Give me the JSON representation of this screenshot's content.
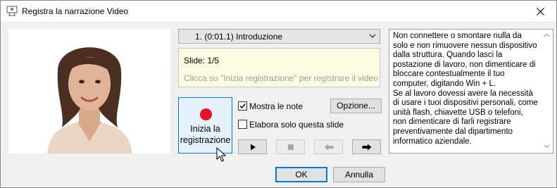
{
  "window": {
    "title": "Registra la narrazione Video"
  },
  "icons": {
    "title": "presenter-screen-icon",
    "close": "close-icon",
    "cursor": "mouse-pointer-icon"
  },
  "slide_select": {
    "selected": "1. (0:01.1) Introduzione"
  },
  "slide_info": {
    "slide_number": "Slide: 1/5",
    "hint": "Clicca su \"Inizia registrazione\" per registrare il video"
  },
  "record_button": {
    "label": "Inizia la registrazione",
    "icon": "record-dot-icon"
  },
  "options": {
    "show_notes": {
      "label": "Mostra le note",
      "checked": true
    },
    "only_this_slide": {
      "label": "Elabora solo questa slide",
      "checked": false
    },
    "options_button": "Opzione..."
  },
  "nav": {
    "play": "play-icon",
    "stop": "stop-icon",
    "prev": "previous-slide-icon",
    "next": "next-slide-icon"
  },
  "notes": {
    "text": "Non connettere o smontare nulla da solo e non rimuovere nessun dispositivo dalla struttura. Quando lasci la postazione di lavoro, non dimenticare di bloccare contestualmente il tuo computer, digitando Win + L.\nSe al lavoro dovessi avere la necessità di usare i tuoi dispositivi personali, come unità flash, chiavette USB o telefoni, non dimenticare di farli registrare preventivamente dal dipartimento informatico aziendale."
  },
  "footer": {
    "ok": "OK",
    "cancel": "Annulla"
  },
  "colors": {
    "accent": "#0078d7",
    "record": "#e81123",
    "slide_info_bg": "#fdfbe1"
  }
}
